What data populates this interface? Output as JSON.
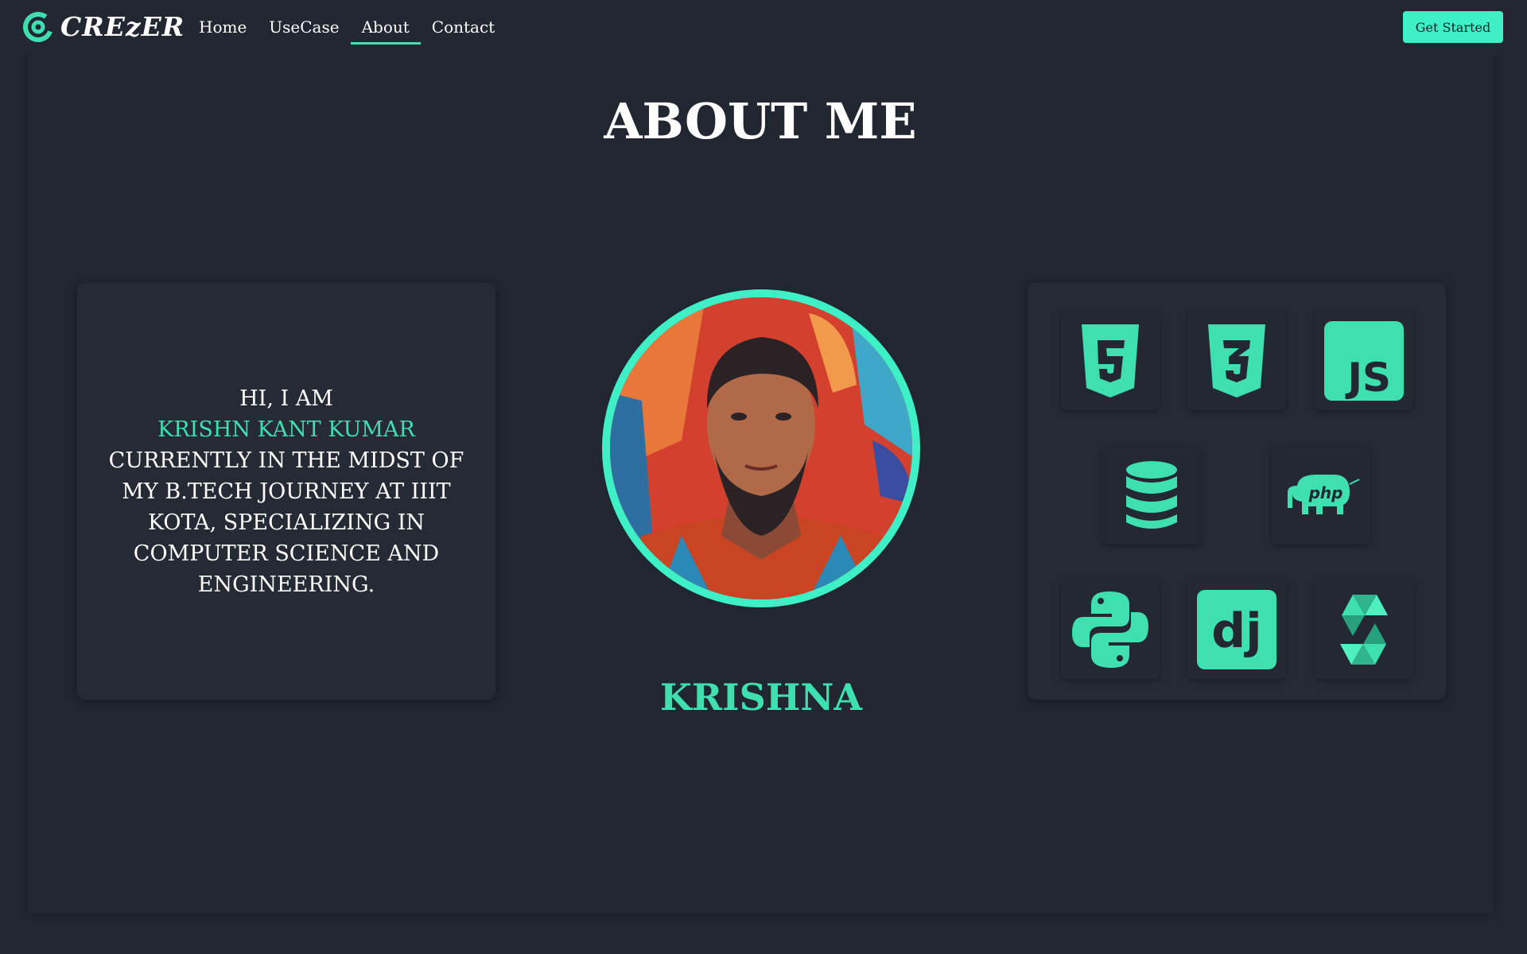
{
  "brand": {
    "name": "CREzER",
    "accent_color": "#3ee0b0",
    "button_color": "#3ef0c5",
    "background_color": "#222731"
  },
  "nav": {
    "items": [
      {
        "label": "Home",
        "active": false
      },
      {
        "label": "UseCase",
        "active": false
      },
      {
        "label": "About",
        "active": true
      },
      {
        "label": "Contact",
        "active": false
      }
    ],
    "cta_label": "Get Started"
  },
  "about": {
    "title": "ABOUT ME",
    "intro": {
      "greeting": "HI, I AM",
      "name": "KRISHN KANT KUMAR",
      "description": "CURRENTLY IN THE MIDST OF MY B.TECH JOURNEY AT IIIT KOTA, SPECIALIZING IN COMPUTER SCIENCE AND ENGINEERING."
    },
    "avatar_caption": "KRISHNA",
    "skills": [
      {
        "icon": "html5-icon"
      },
      {
        "icon": "css3-icon"
      },
      {
        "icon": "javascript-icon",
        "label": "JS"
      },
      {
        "icon": "database-icon"
      },
      {
        "icon": "php-icon",
        "label": "php"
      },
      {
        "icon": "python-icon"
      },
      {
        "icon": "django-icon",
        "label": "dj"
      },
      {
        "icon": "solidity-icon"
      }
    ]
  }
}
